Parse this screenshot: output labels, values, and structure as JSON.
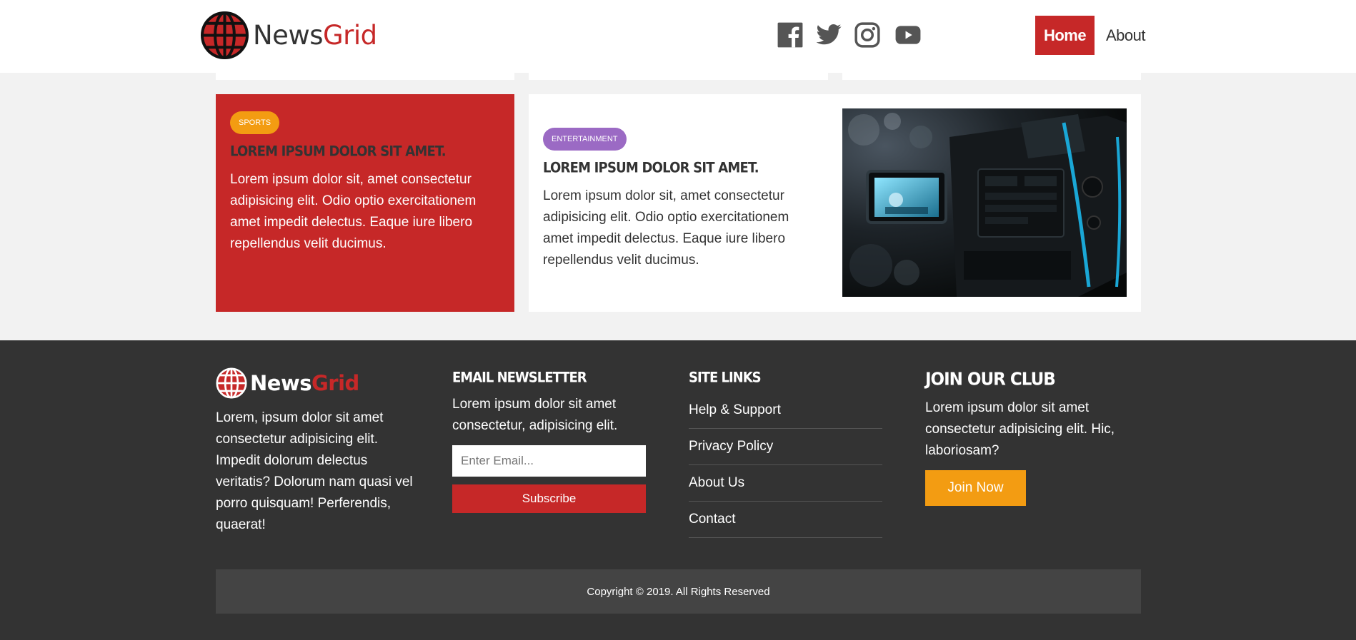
{
  "colors": {
    "brand_red": "#c62828",
    "sports_badge": "#f39c12",
    "entertainment_badge": "#9b6ac4",
    "footer_bg": "#333333",
    "join_button": "#f39c12"
  },
  "header": {
    "logo": {
      "text_main": "News",
      "text_accent": "Grid",
      "icon": "globe-icon"
    },
    "social": [
      {
        "name": "facebook-icon"
      },
      {
        "name": "twitter-icon"
      },
      {
        "name": "instagram-icon"
      },
      {
        "name": "youtube-icon"
      }
    ],
    "nav": {
      "home": "Home",
      "about": "About"
    }
  },
  "cards": {
    "sports": {
      "badge": "SPORTS",
      "title": "LOREM IPSUM DOLOR SIT AMET.",
      "text": "Lorem ipsum dolor sit, amet consectetur adipisicing elit. Odio optio exercitationem amet impedit delectus. Eaque iure libero repellendus velit ducimus."
    },
    "entertainment": {
      "badge": "ENTERTAINMENT",
      "title": "LOREM IPSUM DOLOR SIT AMET.",
      "text": "Lorem ipsum dolor sit, amet consectetur adipisicing elit. Odio optio exercitationem amet impedit delectus. Eaque iure libero repellendus velit ducimus.",
      "image": "video-camera-photo"
    }
  },
  "footer": {
    "logo": {
      "text_main": "News",
      "text_accent": "Grid"
    },
    "about_text": "Lorem, ipsum dolor sit amet consectetur adipisicing elit. Impedit dolorum delectus veritatis? Dolorum nam quasi vel porro quisquam! Perferendis, quaerat!",
    "newsletter": {
      "heading": "EMAIL NEWSLETTER",
      "text": "Lorem ipsum dolor sit amet consectetur, adipisicing elit.",
      "placeholder": "Enter Email...",
      "button": "Subscribe"
    },
    "site_links": {
      "heading": "SITE LINKS",
      "items": [
        "Help & Support",
        "Privacy Policy",
        "About Us",
        "Contact"
      ]
    },
    "club": {
      "heading": "JOIN OUR CLUB",
      "text": "Lorem ipsum dolor sit amet consectetur adipisicing elit. Hic, laboriosam?",
      "button": "Join Now"
    },
    "copyright": "Copyright © 2019. All Rights Reserved"
  }
}
